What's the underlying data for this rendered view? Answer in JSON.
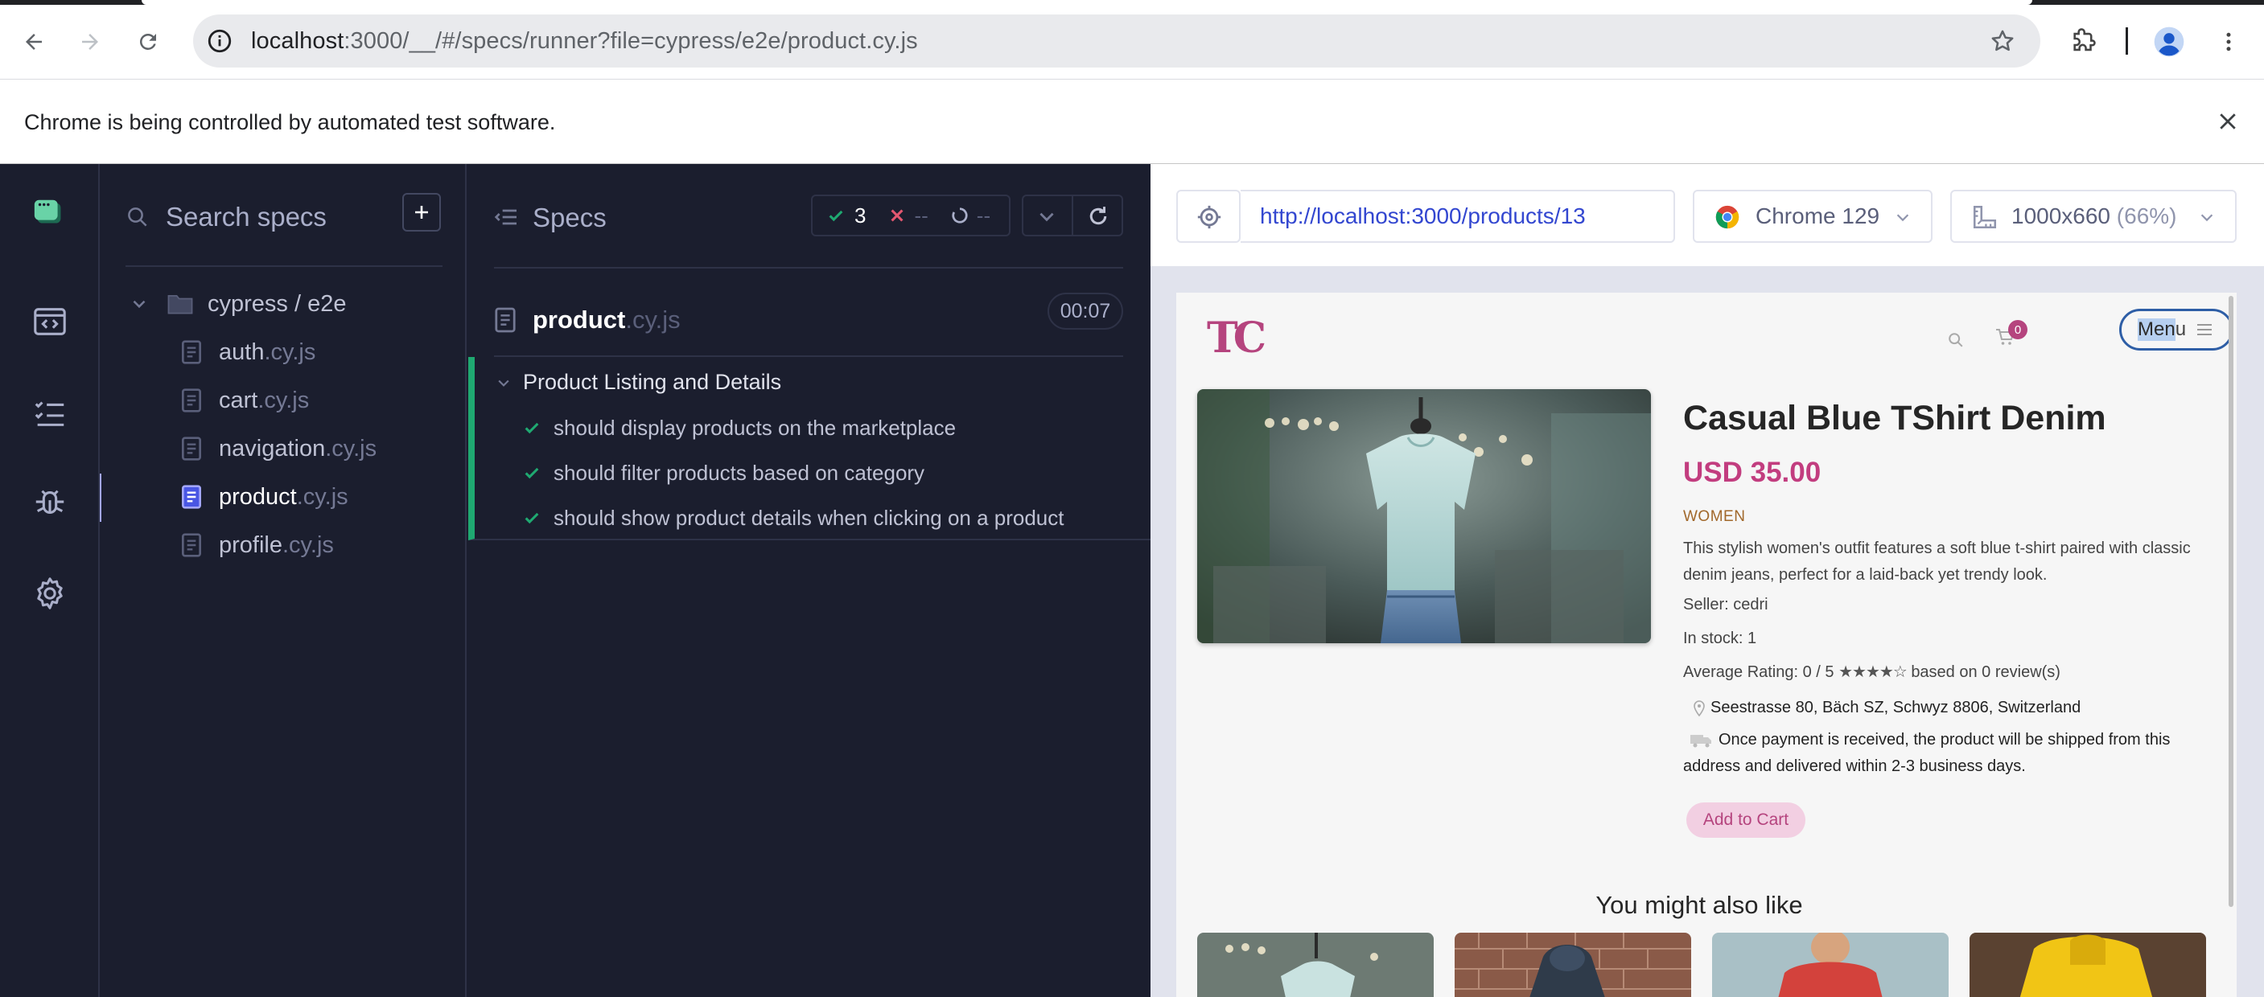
{
  "browser": {
    "url_host": "localhost",
    "url_rest": ":3000/__/#/specs/runner?file=cypress/e2e/product.cy.js",
    "infobar_message": "Chrome is being controlled by automated test software."
  },
  "specs_panel": {
    "search_placeholder": "Search specs",
    "folder": "cypress / e2e",
    "files": [
      {
        "name": "auth",
        "ext": ".cy.js"
      },
      {
        "name": "cart",
        "ext": ".cy.js"
      },
      {
        "name": "navigation",
        "ext": ".cy.js"
      },
      {
        "name": "product",
        "ext": ".cy.js",
        "active": true
      },
      {
        "name": "profile",
        "ext": ".cy.js"
      }
    ]
  },
  "reporter": {
    "title": "Specs",
    "passed": "3",
    "failed": "--",
    "pending": "--",
    "spec_name": "product",
    "spec_ext": ".cy.js",
    "duration": "00:07",
    "suite": "Product Listing and Details",
    "tests": [
      "should display products on the marketplace",
      "should filter products based on category",
      "should show product details when clicking on a product"
    ],
    "colors": {
      "pass": "#1fa971",
      "fail": "#e45770",
      "suite_border": "#1fa971"
    }
  },
  "aut": {
    "url": "http://localhost:3000/products/13",
    "browser": "Chrome 129",
    "viewport": "1000x660",
    "scale": "(66%)"
  },
  "app": {
    "logo": "TC",
    "cart_count": "0",
    "menu_highlight": "Men",
    "menu_rest": "u",
    "product_title": "Casual Blue TShirt Denim",
    "price": "USD 35.00",
    "category": "WOMEN",
    "description": "This stylish women's outfit features a soft blue t-shirt paired with classic denim jeans, perfect for a laid-back yet trendy look.",
    "seller": "Seller: cedri",
    "stock": "In stock: 1",
    "rating_prefix": "Average Rating: 0 / 5",
    "rating_stars": "★★★★☆",
    "rating_suffix": "based on 0 review(s)",
    "address": "Seestrasse 80, Bäch SZ, Schwyz 8806, Switzerland",
    "shipping": "Once payment is received, the product will be shipped from this address and delivered within 2-3 business days.",
    "add_to_cart": "Add to Cart",
    "also_like": "You might also like",
    "brand_color": "#b5447e"
  }
}
